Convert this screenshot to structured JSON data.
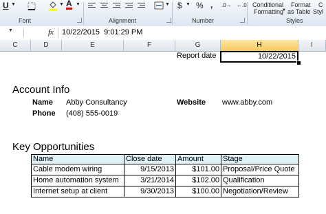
{
  "ribbon": {
    "groups": {
      "font": "Font",
      "alignment": "Alignment",
      "number": "Number",
      "styles": "Styles"
    },
    "underline_glyph": "U",
    "font_color_glyph": "A",
    "currency_glyph": "$",
    "percent_glyph": "%",
    "comma_glyph": ",",
    "conditional_formatting": [
      "Conditional",
      "Formatting"
    ],
    "format_as_table": [
      "Format",
      "as Table"
    ],
    "cell_styles": [
      "C",
      "Styl"
    ]
  },
  "formula_bar": {
    "fx": "fx",
    "value": "10/22/2015  9:01:29 PM"
  },
  "columns": [
    "C",
    "D",
    "E",
    "F",
    "G",
    "H",
    "I"
  ],
  "colors": {
    "header_fill": "#def2f8",
    "selected_col": "#f6c95e",
    "ribbon": "#dde6f2"
  },
  "sheet": {
    "report_label": "Report date",
    "report_date": "10/22/2015",
    "account_title": "Account Info",
    "name_label": "Name",
    "name_value": "Abby Consultancy",
    "phone_label": "Phone",
    "phone_value": "(408) 555-0019",
    "website_label": "Website",
    "website_value": "www.abby.com",
    "opps_title": "Key Opportunities",
    "table": {
      "headers": [
        "Name",
        "Close date",
        "Amount",
        "Stage"
      ],
      "rows": [
        [
          "Cable modem wiring",
          "9/15/2013",
          "$101.00",
          "Proposal/Price Quote"
        ],
        [
          "Home automation system",
          "3/21/2014",
          "$102.00",
          "Qualification"
        ],
        [
          "Internet setup at client",
          "9/30/2013",
          "$100.00",
          "Negotiation/Review"
        ]
      ]
    }
  }
}
